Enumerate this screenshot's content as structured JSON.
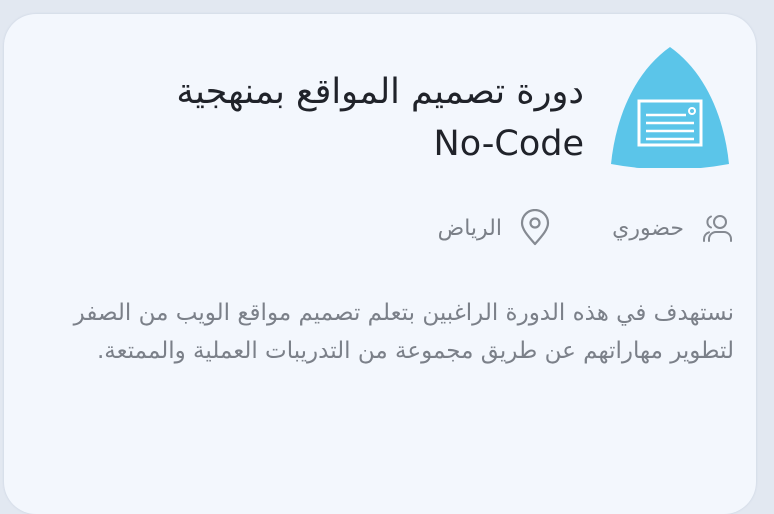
{
  "course": {
    "title_line1": "دورة تصميم المواقع بمنهجية",
    "title_line2": "No-Code",
    "delivery_mode": "حضوري",
    "location": "الرياض",
    "description": "نستهدف في هذه الدورة الراغبين بتعلم تصميم مواقع الويب من الصفر لتطوير مهاراتهم عن طريق مجموعة من التدريبات العملية والممتعة."
  },
  "icons": {
    "logo": "certificate-icon",
    "mode": "users-icon",
    "location": "map-pin-icon"
  },
  "colors": {
    "card_background": "#f3f7fd",
    "logo_fill": "#5bc5e9",
    "title_text": "#20232a",
    "muted_text": "#7b8089"
  }
}
